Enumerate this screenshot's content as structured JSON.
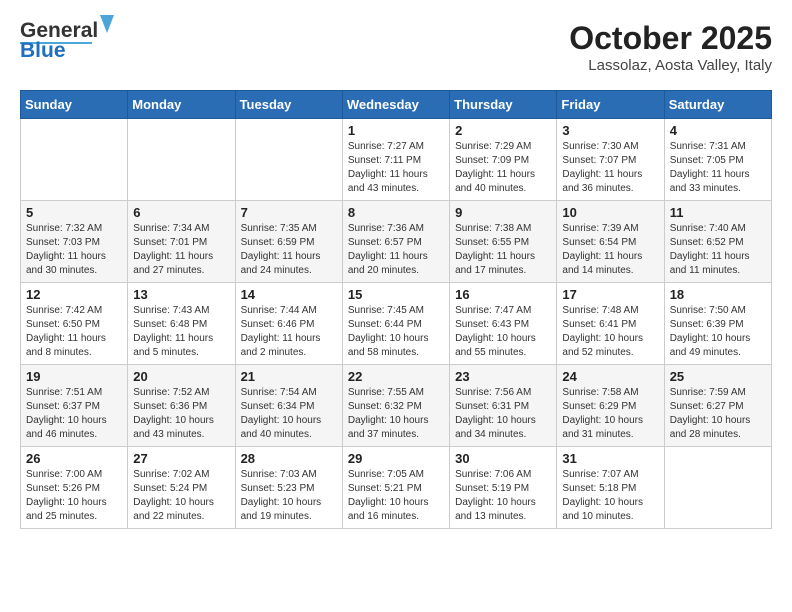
{
  "header": {
    "logo_general": "General",
    "logo_blue": "Blue",
    "month_title": "October 2025",
    "location": "Lassolaz, Aosta Valley, Italy"
  },
  "weekdays": [
    "Sunday",
    "Monday",
    "Tuesday",
    "Wednesday",
    "Thursday",
    "Friday",
    "Saturday"
  ],
  "weeks": [
    [
      {
        "day": "",
        "sunrise": "",
        "sunset": "",
        "daylight": ""
      },
      {
        "day": "",
        "sunrise": "",
        "sunset": "",
        "daylight": ""
      },
      {
        "day": "",
        "sunrise": "",
        "sunset": "",
        "daylight": ""
      },
      {
        "day": "1",
        "sunrise": "Sunrise: 7:27 AM",
        "sunset": "Sunset: 7:11 PM",
        "daylight": "Daylight: 11 hours and 43 minutes."
      },
      {
        "day": "2",
        "sunrise": "Sunrise: 7:29 AM",
        "sunset": "Sunset: 7:09 PM",
        "daylight": "Daylight: 11 hours and 40 minutes."
      },
      {
        "day": "3",
        "sunrise": "Sunrise: 7:30 AM",
        "sunset": "Sunset: 7:07 PM",
        "daylight": "Daylight: 11 hours and 36 minutes."
      },
      {
        "day": "4",
        "sunrise": "Sunrise: 7:31 AM",
        "sunset": "Sunset: 7:05 PM",
        "daylight": "Daylight: 11 hours and 33 minutes."
      }
    ],
    [
      {
        "day": "5",
        "sunrise": "Sunrise: 7:32 AM",
        "sunset": "Sunset: 7:03 PM",
        "daylight": "Daylight: 11 hours and 30 minutes."
      },
      {
        "day": "6",
        "sunrise": "Sunrise: 7:34 AM",
        "sunset": "Sunset: 7:01 PM",
        "daylight": "Daylight: 11 hours and 27 minutes."
      },
      {
        "day": "7",
        "sunrise": "Sunrise: 7:35 AM",
        "sunset": "Sunset: 6:59 PM",
        "daylight": "Daylight: 11 hours and 24 minutes."
      },
      {
        "day": "8",
        "sunrise": "Sunrise: 7:36 AM",
        "sunset": "Sunset: 6:57 PM",
        "daylight": "Daylight: 11 hours and 20 minutes."
      },
      {
        "day": "9",
        "sunrise": "Sunrise: 7:38 AM",
        "sunset": "Sunset: 6:55 PM",
        "daylight": "Daylight: 11 hours and 17 minutes."
      },
      {
        "day": "10",
        "sunrise": "Sunrise: 7:39 AM",
        "sunset": "Sunset: 6:54 PM",
        "daylight": "Daylight: 11 hours and 14 minutes."
      },
      {
        "day": "11",
        "sunrise": "Sunrise: 7:40 AM",
        "sunset": "Sunset: 6:52 PM",
        "daylight": "Daylight: 11 hours and 11 minutes."
      }
    ],
    [
      {
        "day": "12",
        "sunrise": "Sunrise: 7:42 AM",
        "sunset": "Sunset: 6:50 PM",
        "daylight": "Daylight: 11 hours and 8 minutes."
      },
      {
        "day": "13",
        "sunrise": "Sunrise: 7:43 AM",
        "sunset": "Sunset: 6:48 PM",
        "daylight": "Daylight: 11 hours and 5 minutes."
      },
      {
        "day": "14",
        "sunrise": "Sunrise: 7:44 AM",
        "sunset": "Sunset: 6:46 PM",
        "daylight": "Daylight: 11 hours and 2 minutes."
      },
      {
        "day": "15",
        "sunrise": "Sunrise: 7:45 AM",
        "sunset": "Sunset: 6:44 PM",
        "daylight": "Daylight: 10 hours and 58 minutes."
      },
      {
        "day": "16",
        "sunrise": "Sunrise: 7:47 AM",
        "sunset": "Sunset: 6:43 PM",
        "daylight": "Daylight: 10 hours and 55 minutes."
      },
      {
        "day": "17",
        "sunrise": "Sunrise: 7:48 AM",
        "sunset": "Sunset: 6:41 PM",
        "daylight": "Daylight: 10 hours and 52 minutes."
      },
      {
        "day": "18",
        "sunrise": "Sunrise: 7:50 AM",
        "sunset": "Sunset: 6:39 PM",
        "daylight": "Daylight: 10 hours and 49 minutes."
      }
    ],
    [
      {
        "day": "19",
        "sunrise": "Sunrise: 7:51 AM",
        "sunset": "Sunset: 6:37 PM",
        "daylight": "Daylight: 10 hours and 46 minutes."
      },
      {
        "day": "20",
        "sunrise": "Sunrise: 7:52 AM",
        "sunset": "Sunset: 6:36 PM",
        "daylight": "Daylight: 10 hours and 43 minutes."
      },
      {
        "day": "21",
        "sunrise": "Sunrise: 7:54 AM",
        "sunset": "Sunset: 6:34 PM",
        "daylight": "Daylight: 10 hours and 40 minutes."
      },
      {
        "day": "22",
        "sunrise": "Sunrise: 7:55 AM",
        "sunset": "Sunset: 6:32 PM",
        "daylight": "Daylight: 10 hours and 37 minutes."
      },
      {
        "day": "23",
        "sunrise": "Sunrise: 7:56 AM",
        "sunset": "Sunset: 6:31 PM",
        "daylight": "Daylight: 10 hours and 34 minutes."
      },
      {
        "day": "24",
        "sunrise": "Sunrise: 7:58 AM",
        "sunset": "Sunset: 6:29 PM",
        "daylight": "Daylight: 10 hours and 31 minutes."
      },
      {
        "day": "25",
        "sunrise": "Sunrise: 7:59 AM",
        "sunset": "Sunset: 6:27 PM",
        "daylight": "Daylight: 10 hours and 28 minutes."
      }
    ],
    [
      {
        "day": "26",
        "sunrise": "Sunrise: 7:00 AM",
        "sunset": "Sunset: 5:26 PM",
        "daylight": "Daylight: 10 hours and 25 minutes."
      },
      {
        "day": "27",
        "sunrise": "Sunrise: 7:02 AM",
        "sunset": "Sunset: 5:24 PM",
        "daylight": "Daylight: 10 hours and 22 minutes."
      },
      {
        "day": "28",
        "sunrise": "Sunrise: 7:03 AM",
        "sunset": "Sunset: 5:23 PM",
        "daylight": "Daylight: 10 hours and 19 minutes."
      },
      {
        "day": "29",
        "sunrise": "Sunrise: 7:05 AM",
        "sunset": "Sunset: 5:21 PM",
        "daylight": "Daylight: 10 hours and 16 minutes."
      },
      {
        "day": "30",
        "sunrise": "Sunrise: 7:06 AM",
        "sunset": "Sunset: 5:19 PM",
        "daylight": "Daylight: 10 hours and 13 minutes."
      },
      {
        "day": "31",
        "sunrise": "Sunrise: 7:07 AM",
        "sunset": "Sunset: 5:18 PM",
        "daylight": "Daylight: 10 hours and 10 minutes."
      },
      {
        "day": "",
        "sunrise": "",
        "sunset": "",
        "daylight": ""
      }
    ]
  ]
}
